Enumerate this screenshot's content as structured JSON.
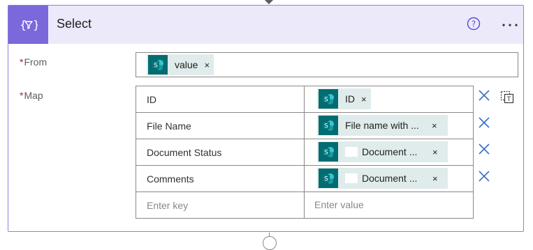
{
  "action": {
    "title": "Select",
    "icon": "data-operation-select-icon",
    "accent_color": "#7b68db",
    "header_bg": "#ece9fb"
  },
  "from": {
    "label": "From",
    "required_mark": "*",
    "token": {
      "label": "value",
      "icon": "sharepoint-icon"
    }
  },
  "map": {
    "label": "Map",
    "required_mark": "*",
    "rows": [
      {
        "key": "ID",
        "value": "ID"
      },
      {
        "key": "File Name",
        "value": "File name with ..."
      },
      {
        "key": "Document Status",
        "value": "Document ..."
      },
      {
        "key": "Comments",
        "value": "Document ..."
      }
    ],
    "key_placeholder": "Enter key",
    "value_placeholder": "Enter value"
  },
  "token_remove_glyph": "×",
  "sharepoint_color": "#036c70",
  "token_bg": "#dfeceb"
}
